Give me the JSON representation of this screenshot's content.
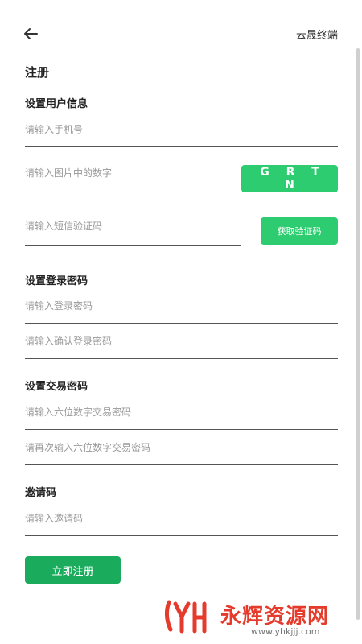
{
  "header": {
    "brand": "云晟终端"
  },
  "page": {
    "title": "注册"
  },
  "sections": {
    "user_info": "设置用户信息",
    "login_password": "设置登录密码",
    "trade_password": "设置交易密码",
    "invite": "邀请码"
  },
  "fields": {
    "phone": {
      "placeholder": "请输入手机号",
      "value": ""
    },
    "captcha": {
      "placeholder": "请输入图片中的数字",
      "value": ""
    },
    "sms_code": {
      "placeholder": "请输入短信验证码",
      "value": ""
    },
    "login_password": {
      "placeholder": "请输入登录密码",
      "value": ""
    },
    "login_password_confirm": {
      "placeholder": "请输入确认登录密码",
      "value": ""
    },
    "trade_password": {
      "placeholder": "请输入六位数字交易密码",
      "value": ""
    },
    "trade_password_confirm": {
      "placeholder": "请再次输入六位数字交易密码",
      "value": ""
    },
    "invite_code": {
      "placeholder": "请输入邀请码",
      "value": ""
    }
  },
  "buttons": {
    "captcha_image": "G R T N",
    "get_sms_code": "获取验证码",
    "register": "立即注册"
  },
  "watermark": {
    "name": "永辉资源网",
    "url": "www.yhkjjj.com"
  },
  "colors": {
    "accent": "#2ecc71",
    "register": "#1aab5c",
    "watermark": "#e53b2c"
  },
  "icons": {
    "back": "arrow-left-icon"
  }
}
